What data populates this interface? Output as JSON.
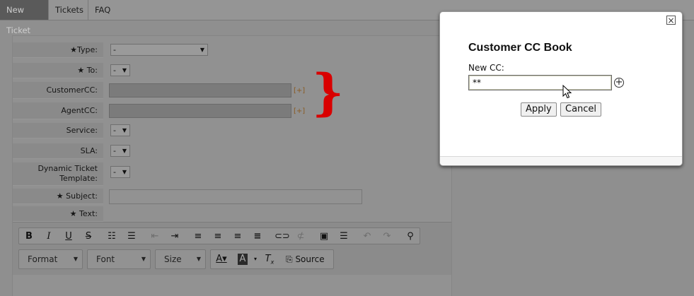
{
  "nav": {
    "tabs": [
      {
        "label": "New Ticket"
      },
      {
        "label": "Tickets"
      },
      {
        "label": "FAQ"
      }
    ]
  },
  "form": {
    "type_label": "Type:",
    "type_value": "-",
    "to_label": "To:",
    "to_value": "-",
    "customercc_label": "CustomerCC:",
    "customercc_link": "[+]",
    "agentcc_label": "AgentCC:",
    "agentcc_link": "[+]",
    "service_label": "Service:",
    "service_value": "-",
    "sla_label": "SLA:",
    "sla_value": "-",
    "template_label_line1": "Dynamic Ticket",
    "template_label_line2": "Template:",
    "template_value": "-",
    "subject_label": "Subject:",
    "text_label": "Text:",
    "required_star": "★"
  },
  "editor": {
    "format_label": "Format",
    "font_label": "Font",
    "size_label": "Size",
    "source_label": "Source"
  },
  "dialog": {
    "title": "Customer CC Book",
    "newcc_label": "New CC:",
    "newcc_value": "**",
    "apply_label": "Apply",
    "cancel_label": "Cancel"
  },
  "annotation": {
    "color": "#d90000"
  }
}
